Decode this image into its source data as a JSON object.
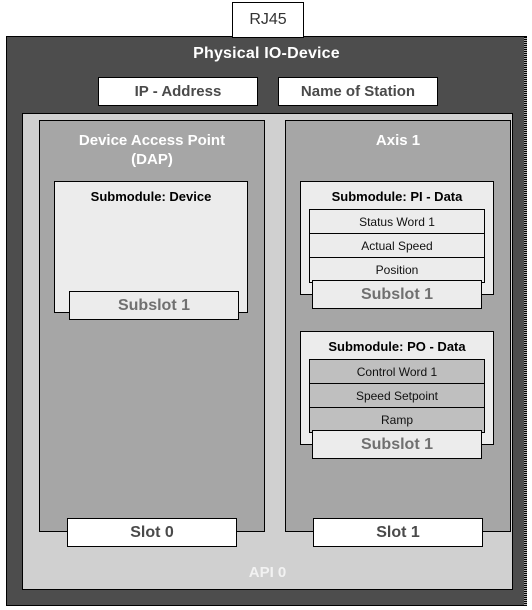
{
  "connector": {
    "label": "RJ45"
  },
  "device": {
    "title": "Physical IO-Device",
    "attributes": [
      {
        "label": "IP - Address"
      },
      {
        "label": "Name of Station"
      }
    ]
  },
  "api": {
    "label": "API 0",
    "modules": [
      {
        "title": "Device Access Point\n(DAP)",
        "title_line1": "Device Access Point",
        "title_line2": "(DAP)",
        "slot_label": "Slot 0",
        "submodules": [
          {
            "title": "Submodule: Device",
            "subslot_label": "Subslot 1",
            "rows": []
          }
        ]
      },
      {
        "title": "Axis 1",
        "title_line1": "Axis 1",
        "title_line2": "",
        "slot_label": "Slot 1",
        "submodules": [
          {
            "title": "Submodule: PI - Data",
            "subslot_label": "Subslot 1",
            "rows": [
              {
                "label": "Status Word 1"
              },
              {
                "label": "Actual Speed"
              },
              {
                "label": "Position"
              }
            ]
          },
          {
            "title": "Submodule: PO - Data",
            "subslot_label": "Subslot 1",
            "rows": [
              {
                "label": "Control Word 1"
              },
              {
                "label": "Speed Setpoint"
              },
              {
                "label": "Ramp"
              }
            ]
          }
        ]
      }
    ]
  },
  "colors": {
    "device_frame": "#4d4d4d",
    "api_background": "#d0d0d0",
    "module_background": "#a6a6a6",
    "submodule_background": "#ececec",
    "row_gray": "#bfbfbf",
    "box_white": "#ffffff",
    "outline": "#000000"
  }
}
